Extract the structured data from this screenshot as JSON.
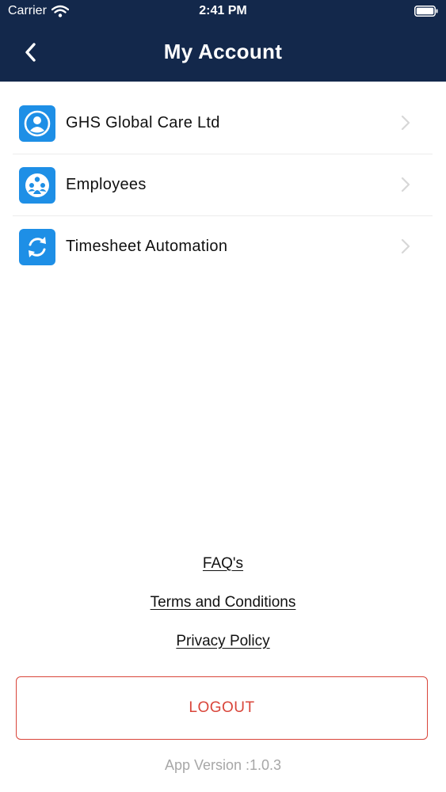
{
  "status_bar": {
    "carrier": "Carrier",
    "time": "2:41 PM"
  },
  "header": {
    "title": "My Account",
    "background_color": "#13284b",
    "back_icon": "chevron-left-icon"
  },
  "menu": {
    "items": [
      {
        "label": "GHS Global Care Ltd",
        "icon": "user-profile-icon"
      },
      {
        "label": "Employees",
        "icon": "employees-group-icon"
      },
      {
        "label": "Timesheet Automation",
        "icon": "sync-icon"
      }
    ],
    "icon_color": "#1e8fe6"
  },
  "footer": {
    "links": [
      {
        "label": "FAQ's"
      },
      {
        "label": "Terms and Conditions"
      },
      {
        "label": "Privacy Policy"
      }
    ],
    "logout_label": "LOGOUT",
    "logout_color": "#d9453a",
    "app_version": "App Version :1.0.3"
  }
}
